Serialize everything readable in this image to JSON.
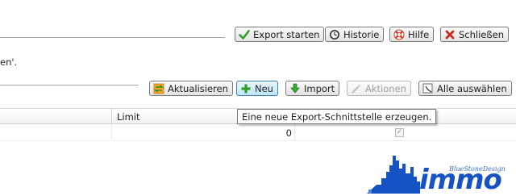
{
  "toolbar_top": {
    "export_label": "Export starten",
    "history_label": "Historie",
    "help_label": "Hilfe",
    "close_label": "Schließen"
  },
  "hint_text": "en'.",
  "toolbar_grid": {
    "refresh_label": "Aktualisieren",
    "new_label": "Neu",
    "import_label": "Import",
    "actions_label": "Aktionen",
    "select_all_label": "Alle auswählen"
  },
  "grid": {
    "columns": [
      "Limit"
    ],
    "rows": [
      {
        "limit": "0",
        "checked": true
      }
    ]
  },
  "tooltip": "Eine neue Export-Schnittstelle erzeugen.",
  "logo": {
    "word": "immo",
    "tagline": "BlueStoneDesign"
  },
  "colors": {
    "accent": "#1553c4",
    "pressed": "#bee6fd"
  }
}
